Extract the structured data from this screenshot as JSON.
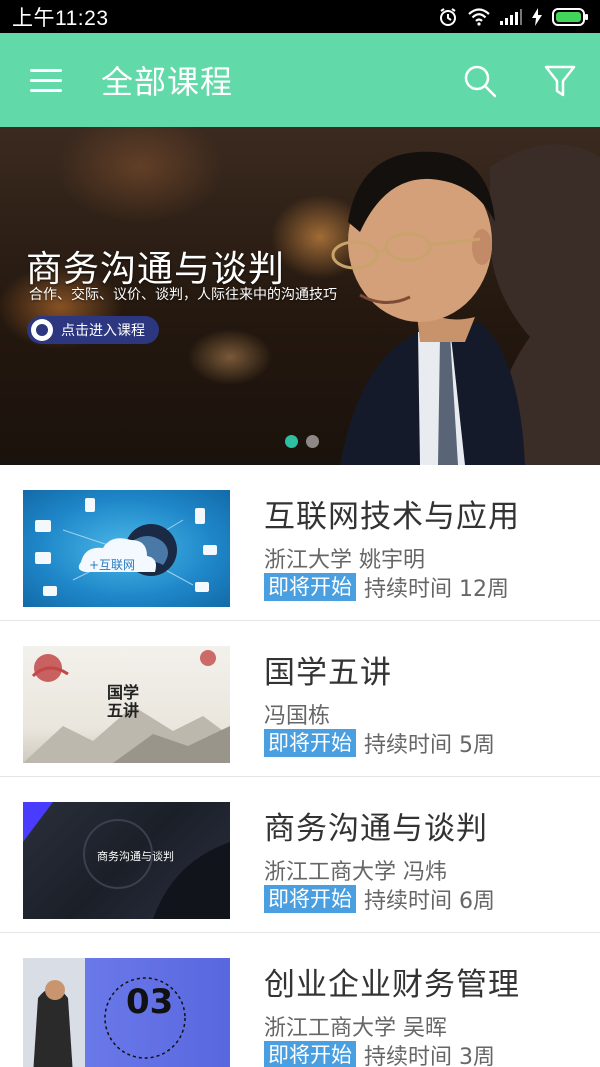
{
  "status_bar": {
    "time": "上午11:23",
    "icons": [
      "alarm-icon",
      "wifi-icon",
      "signal-icon",
      "charging-icon",
      "battery-icon"
    ]
  },
  "app_bar": {
    "title": "全部课程",
    "icons": [
      "menu-icon",
      "search-icon",
      "filter-icon"
    ]
  },
  "banner": {
    "title": "商务沟通与谈判",
    "subtitle": "合作、交际、议价、谈判，人际往来中的沟通技巧",
    "button_label": "点击进入课程",
    "slide_count": 2,
    "active_slide": 0
  },
  "courses": [
    {
      "name": "互联网技术与应用",
      "org": "浙江大学 姚宇明",
      "badge": "即将开始",
      "duration": "持续时间 12周",
      "thumb_text": "+互联网"
    },
    {
      "name": "国学五讲",
      "org": " 冯国栋",
      "badge": "即将开始",
      "duration": "持续时间 5周",
      "thumb_text": "国学五讲"
    },
    {
      "name": "商务沟通与谈判",
      "org": "浙江工商大学 冯炜",
      "badge": "即将开始",
      "duration": "持续时间 6周",
      "thumb_text": "商务沟通与谈判"
    },
    {
      "name": "创业企业财务管理",
      "org": "浙江工商大学 吴晖",
      "badge": "即将开始",
      "duration": "持续时间 3周",
      "thumb_text": "03"
    }
  ],
  "colors": {
    "app_bar": "#62d9a8",
    "badge": "#4a9fe0",
    "active_dot": "#2fbfa0"
  }
}
